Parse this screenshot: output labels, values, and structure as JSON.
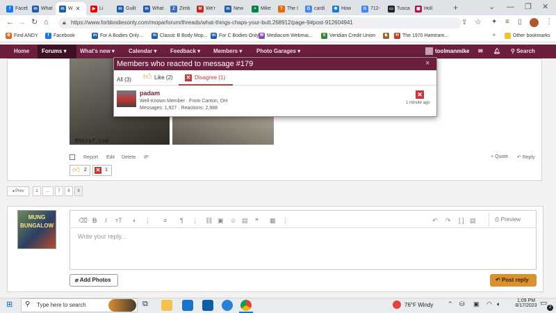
{
  "browser": {
    "tabs": [
      {
        "label": "Faceb",
        "color": "#1877f2",
        "glyph": "f"
      },
      {
        "label": "What",
        "color": "#1e5fa8",
        "glyph": "m"
      },
      {
        "label": "W",
        "color": "#1e5fa8",
        "glyph": "m",
        "active": true
      },
      {
        "label": "Li",
        "color": "#e00",
        "glyph": "▶"
      },
      {
        "label": "Guilt",
        "color": "#1e5fa8",
        "glyph": "m"
      },
      {
        "label": "What",
        "color": "#1e5fa8",
        "glyph": "m"
      },
      {
        "label": "Zimb",
        "color": "#3b6fb6",
        "glyph": "Z"
      },
      {
        "label": "We'r",
        "color": "#c5221f",
        "glyph": "M"
      },
      {
        "label": "New",
        "color": "#1e5fa8",
        "glyph": "m"
      },
      {
        "label": "Mike",
        "color": "#0a8043",
        "glyph": "+"
      },
      {
        "label": "The I",
        "color": "#e36b0b",
        "glyph": "T"
      },
      {
        "label": "cardi",
        "color": "#4285f4",
        "glyph": "G"
      },
      {
        "label": "How",
        "color": "#1e7bd9",
        "glyph": "✱"
      },
      {
        "label": "712-",
        "color": "#4285f4",
        "glyph": "G"
      },
      {
        "label": "Tusca",
        "color": "#223",
        "glyph": "▭"
      },
      {
        "label": "Holl",
        "color": "#b01343",
        "glyph": "▣"
      }
    ],
    "new_tab": "+",
    "url": "https://www.forbbodiesonly.com/moparforum/threads/what-things-chaps-your-butt.268912/page-9#post-912604941",
    "bookmarks": [
      {
        "label": "Find ANDY",
        "color": "#e5642b",
        "glyph": "⊕"
      },
      {
        "label": "Facebook",
        "color": "#1877f2",
        "glyph": "f"
      },
      {
        "label": "For A Bodies Only...",
        "color": "#1e5fa8",
        "glyph": "m"
      },
      {
        "label": "Classic B Body Mop...",
        "color": "#1e5fa8",
        "glyph": "m"
      },
      {
        "label": "For C Bodies Only",
        "color": "#1e5fa8",
        "glyph": "m"
      },
      {
        "label": "Mediacom Webmai...",
        "color": "#8a4fbf",
        "glyph": "✉"
      },
      {
        "label": "Veridian Credit Union",
        "color": "#2d8a3e",
        "glyph": "V"
      },
      {
        "label": "",
        "color": "#9a6a2a",
        "glyph": "♞"
      },
      {
        "label": "The 1970 Hamtram...",
        "color": "#c04020",
        "glyph": "H"
      }
    ],
    "bookmarks_more": "»",
    "other_bookmarks": "Other bookmarks",
    "window_controls": [
      "⌄",
      "—",
      "❐",
      "✕"
    ]
  },
  "site_nav": {
    "items": [
      "Home",
      "Forums",
      "What's new",
      "Calendar",
      "Feedback",
      "Members",
      "Photo Garages"
    ],
    "username": "toolmanmike",
    "search_label": "Search"
  },
  "post": {
    "watermark": "Mthruf.com",
    "actions": [
      "Report",
      "Edit",
      "Delete",
      "IP"
    ],
    "quote_label": "+ Quote",
    "reply_label": "Reply",
    "reaction_like_count": "2",
    "reaction_disagree_count": "1"
  },
  "pagination": {
    "prev": "◂ Prev",
    "pages": [
      "1",
      "...",
      "7",
      "8",
      "9"
    ]
  },
  "editor": {
    "placeholder": "Write your reply...",
    "preview_label": "Preview",
    "add_photos_label": "Add Photos",
    "post_reply_label": "Post reply",
    "avatar_text": "MUNG BUNGALOW"
  },
  "modal": {
    "title": "Members who reacted to message #179",
    "close": "×",
    "tabs": [
      {
        "label": "All (3)"
      },
      {
        "label": "Like (2)"
      },
      {
        "label": "Disagree (1)"
      }
    ],
    "member": {
      "name": "padam",
      "title_line": "Well-Known Member · From Canton, OH",
      "stats_line": "Messages: 1,927 · Reactions: 2,988",
      "time": "1 minute ago"
    }
  },
  "taskbar": {
    "search_placeholder": "Type here to search",
    "weather": "76°F  Windy",
    "time": "1:09 PM",
    "date": "8/17/2023",
    "notification_count": "2"
  },
  "colors": {
    "nav_bg": "#6b1f3c",
    "nav_active": "#3d1023",
    "post_reply_bg": "#d9902e",
    "disagree_red": "#c0393b"
  }
}
